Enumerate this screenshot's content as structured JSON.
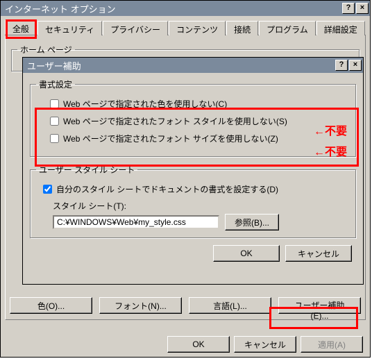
{
  "window": {
    "title": "インターネット オプション",
    "help": "?",
    "close": "×"
  },
  "tabs": {
    "general": "全般",
    "security": "セキュリティ",
    "privacy": "プライバシー",
    "content": "コンテンツ",
    "connections": "接続",
    "programs": "プログラム",
    "advanced": "詳細設定"
  },
  "homepage": {
    "legend": "ホーム ページ"
  },
  "accessibility_dialog": {
    "title": "ユーザー補助",
    "help": "?",
    "close": "×",
    "format_legend": "書式設定",
    "chk_color": "Web ページで指定された色を使用しない(C)",
    "chk_fontstyle": "Web ページで指定されたフォント スタイルを使用しない(S)",
    "chk_fontsize": "Web ページで指定されたフォント サイズを使用しない(Z)",
    "userstyle_legend": "ユーザー スタイル シート",
    "chk_userstyle": "自分のスタイル シートでドキュメントの書式を設定する(D)",
    "sheet_label": "スタイル シート(T):",
    "sheet_value": "C:¥WINDOWS¥Web¥my_style.css",
    "browse": "参照(B)...",
    "ok": "OK",
    "cancel": "キャンセル"
  },
  "panel_buttons": {
    "colors": "色(O)...",
    "fonts": "フォント(N)...",
    "languages": "言語(L)...",
    "accessibility": "ユーザー補助(E)..."
  },
  "main_buttons": {
    "ok": "OK",
    "cancel": "キャンセル",
    "apply": "適用(A)"
  },
  "annotations": {
    "fuyou1": "←不要",
    "fuyou2": "←不要"
  }
}
